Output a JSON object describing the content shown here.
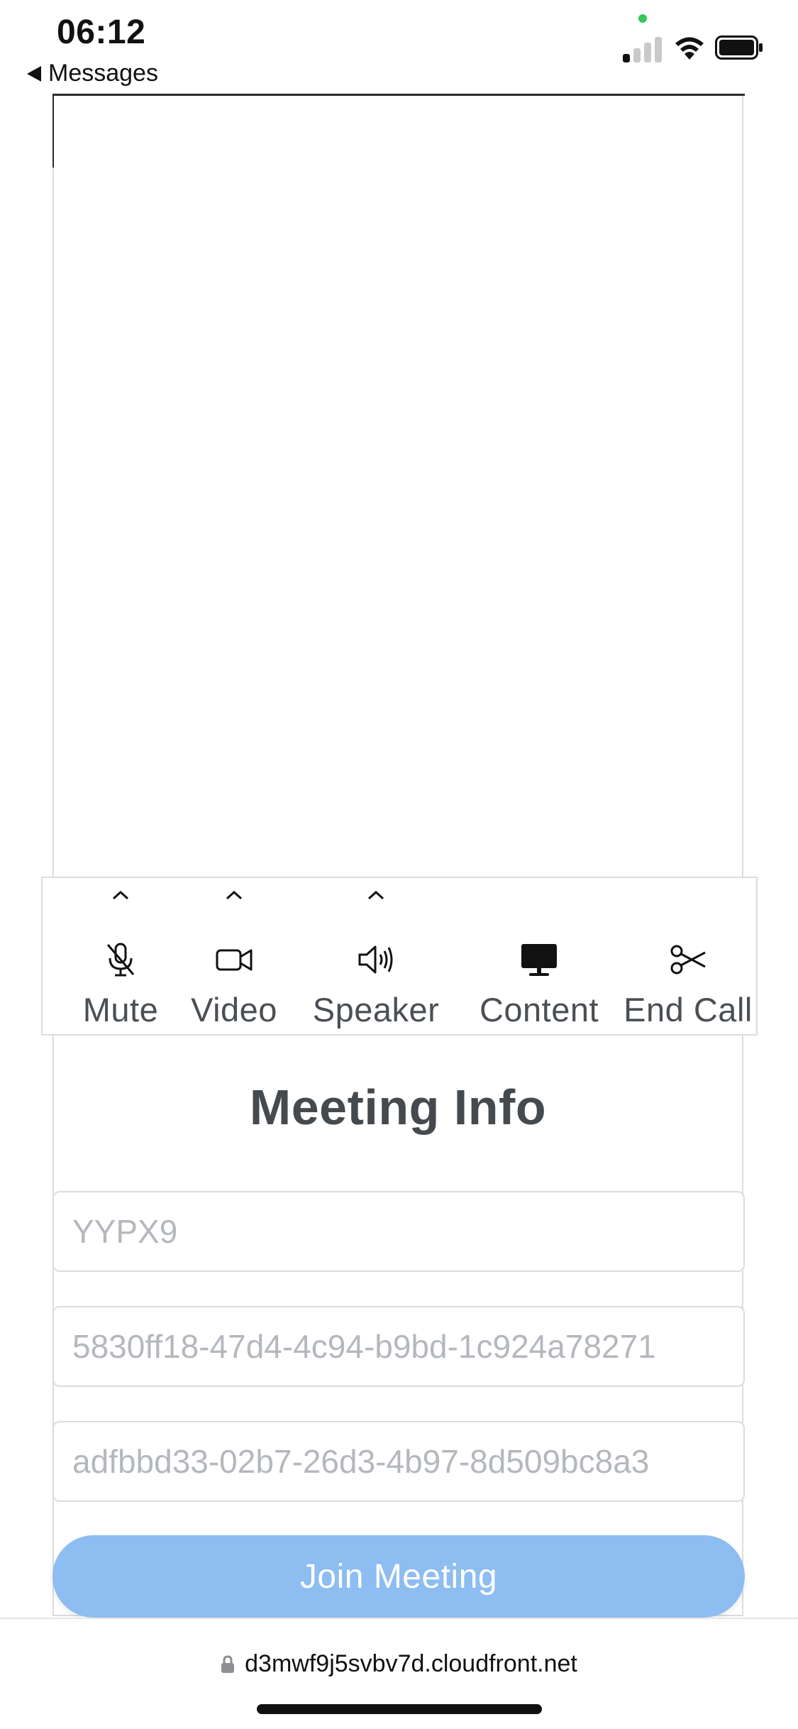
{
  "status_bar": {
    "time": "06:12",
    "back_label": "Messages"
  },
  "controls": [
    {
      "label": "Mute",
      "icon": "microphone-muted-icon",
      "has_menu": true
    },
    {
      "label": "Video",
      "icon": "video-camera-icon",
      "has_menu": true
    },
    {
      "label": "Speaker",
      "icon": "speaker-icon",
      "has_menu": true
    },
    {
      "label": "Content",
      "icon": "monitor-icon",
      "has_menu": false
    },
    {
      "label": "End Call",
      "icon": "scissors-icon",
      "has_menu": false
    }
  ],
  "meeting_info": {
    "title": "Meeting Info",
    "fields": [
      {
        "placeholder": "YYPX9"
      },
      {
        "placeholder": "5830ff18-47d4-4c94-b9bd-1c924a78271"
      },
      {
        "placeholder": "adfbbd33-02b7-26d3-4b97-8d509bc8a3"
      }
    ],
    "join_label": "Join Meeting"
  },
  "browser": {
    "url": "d3mwf9j5svbv7d.cloudfront.net"
  },
  "colors": {
    "join_button": "#8dbdf1",
    "label_text": "#4a4f54",
    "placeholder_text": "#b4b8bd"
  }
}
